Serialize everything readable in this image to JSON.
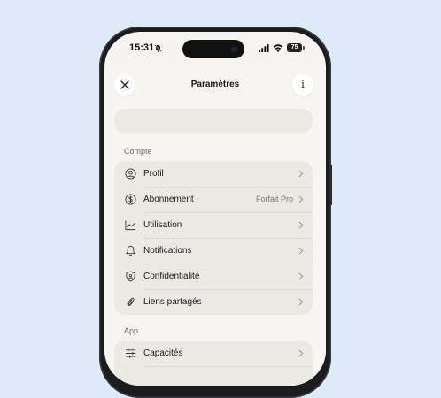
{
  "status_bar": {
    "time": "15:31",
    "battery": "75"
  },
  "header": {
    "title": "Paramètres",
    "info_glyph": "i"
  },
  "search": {
    "placeholder": ""
  },
  "sections": {
    "account": {
      "label": "Compte",
      "items": [
        {
          "label": "Profil",
          "icon": "user-circle-icon"
        },
        {
          "label": "Abonnement",
          "value": "Forfait Pro",
          "icon": "dollar-circle-icon"
        },
        {
          "label": "Utilisation",
          "icon": "chart-line-icon"
        },
        {
          "label": "Notifications",
          "icon": "bell-icon"
        },
        {
          "label": "Confidentialité",
          "icon": "shield-icon"
        },
        {
          "label": "Liens partagés",
          "icon": "link-icon"
        }
      ]
    },
    "app": {
      "label": "App",
      "items": [
        {
          "label": "Capacités",
          "icon": "sliders-icon"
        }
      ]
    }
  }
}
